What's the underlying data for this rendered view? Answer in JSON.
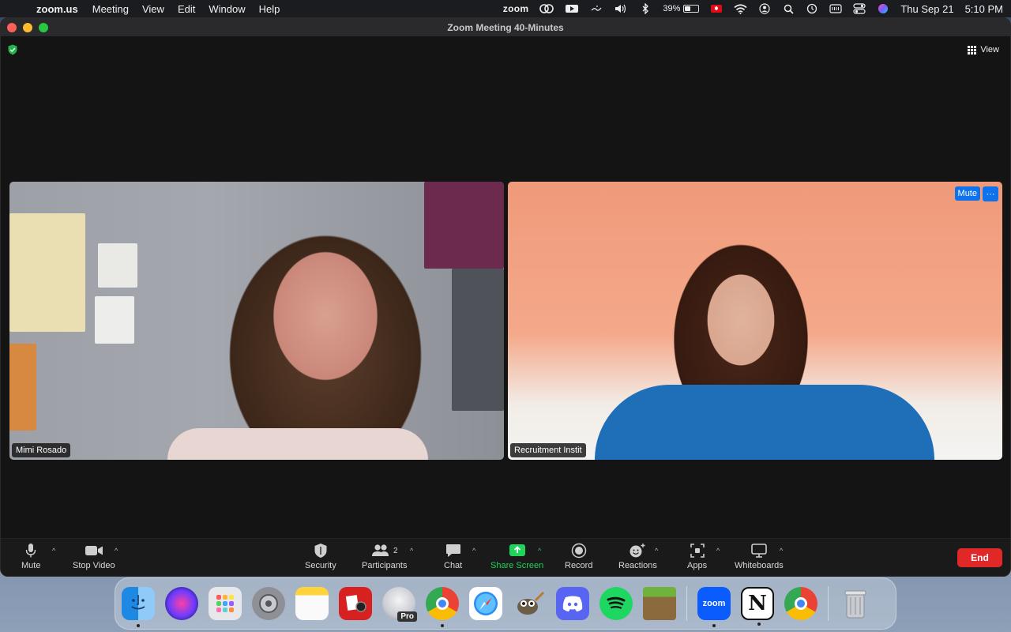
{
  "menubar": {
    "app_name": "zoom.us",
    "menus": [
      "Meeting",
      "View",
      "Edit",
      "Window",
      "Help"
    ],
    "zoom_label": "zoom",
    "battery_percent": "39%",
    "battery_level": 0.39,
    "date": "Thu Sep 21",
    "time": "5:10 PM"
  },
  "window": {
    "title": "Zoom Meeting  40-Minutes",
    "view_label": "View"
  },
  "participants": [
    {
      "name": "Mimi Rosado"
    },
    {
      "name": "Recruitment Instit",
      "mute_label": "Mute",
      "more_label": "···"
    }
  ],
  "toolbar": {
    "mute": "Mute",
    "stop_video": "Stop Video",
    "security": "Security",
    "participants": "Participants",
    "participants_count": "2",
    "chat": "Chat",
    "share_screen": "Share Screen",
    "record": "Record",
    "reactions": "Reactions",
    "apps": "Apps",
    "whiteboards": "Whiteboards",
    "end": "End"
  },
  "dock": {
    "zoom_label": "zoom",
    "pro_label": "Pro",
    "notion_label": "N"
  },
  "colors": {
    "zoom_blue": "#0e72ed",
    "end_red": "#e02828",
    "share_green": "#1fd35b"
  }
}
